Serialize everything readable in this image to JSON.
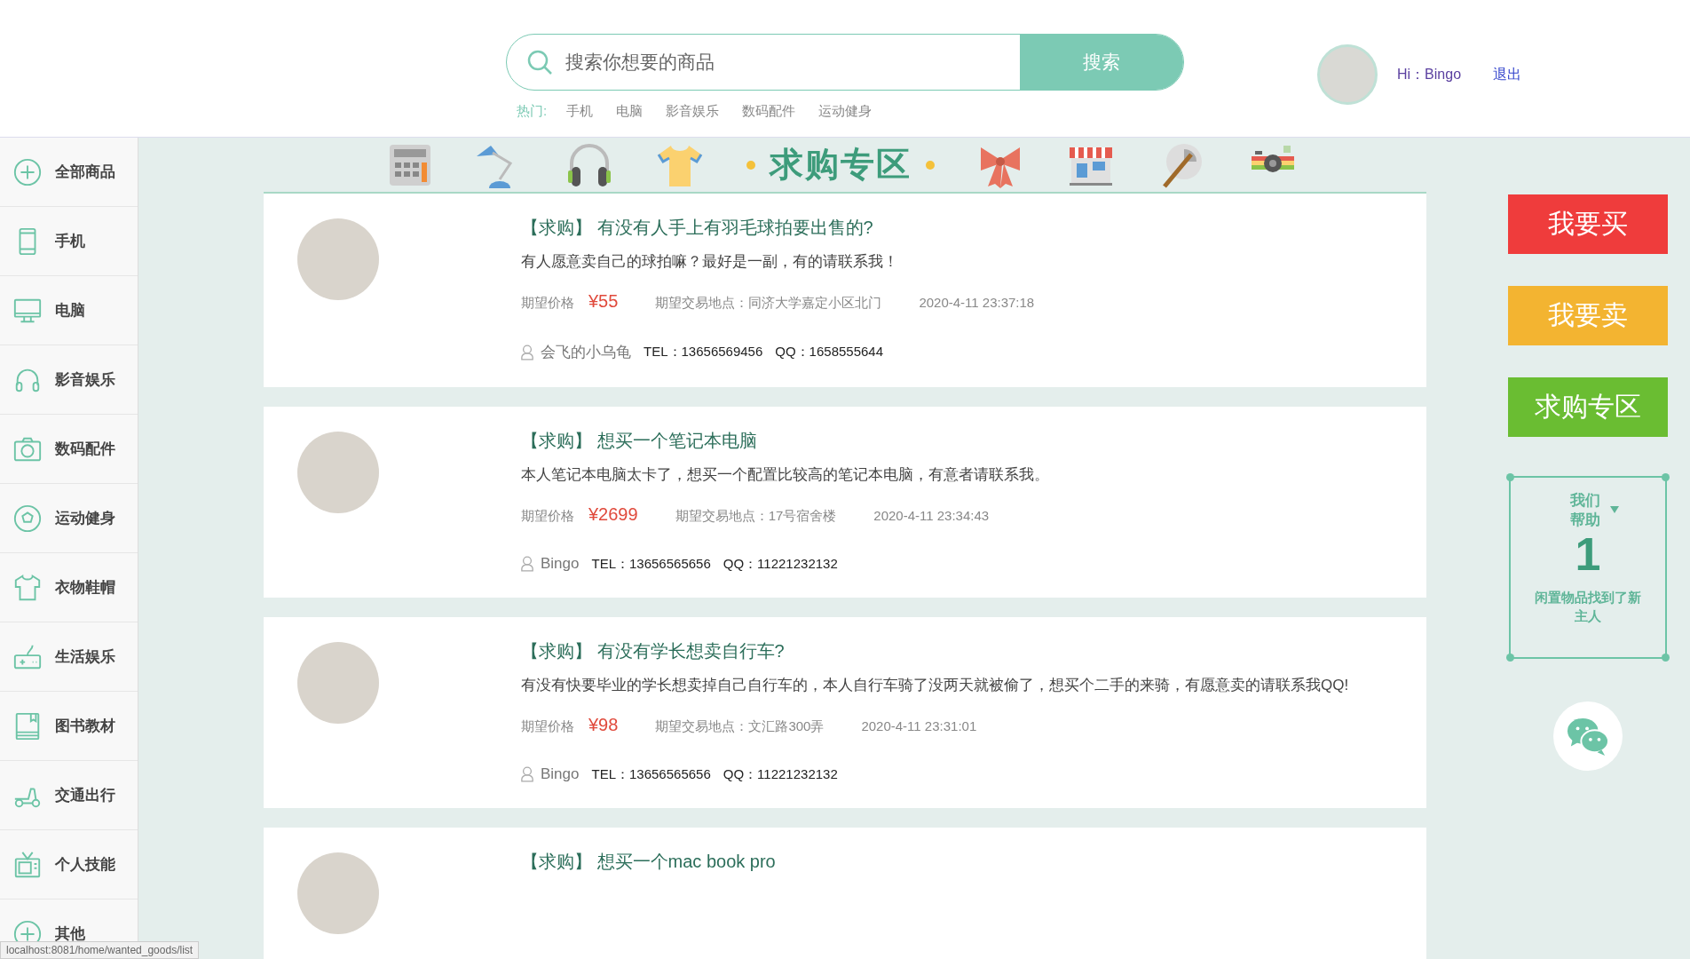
{
  "search": {
    "placeholder": "搜索你想要的商品",
    "button": "搜索"
  },
  "hot": {
    "label": "热门:",
    "items": [
      "手机",
      "电脑",
      "影音娱乐",
      "数码配件",
      "运动健身"
    ]
  },
  "user": {
    "greeting": "Hi：Bingo",
    "logout": "退出"
  },
  "sidebar": {
    "items": [
      {
        "label": "全部商品",
        "kind": "plus"
      },
      {
        "label": "手机",
        "kind": "phone"
      },
      {
        "label": "电脑",
        "kind": "monitor"
      },
      {
        "label": "影音娱乐",
        "kind": "headphones"
      },
      {
        "label": "数码配件",
        "kind": "camera"
      },
      {
        "label": "运动健身",
        "kind": "ball"
      },
      {
        "label": "衣物鞋帽",
        "kind": "shirt"
      },
      {
        "label": "生活娱乐",
        "kind": "gamepad"
      },
      {
        "label": "图书教材",
        "kind": "book"
      },
      {
        "label": "交通出行",
        "kind": "scooter"
      },
      {
        "label": "个人技能",
        "kind": "tv"
      },
      {
        "label": "其他",
        "kind": "plus"
      }
    ]
  },
  "banner": {
    "title": "求购专区"
  },
  "posts": [
    {
      "tag": "【求购】",
      "title": "有没有人手上有羽毛球拍要出售的?",
      "description": "有人愿意卖自己的球拍嘛？最好是一副，有的请联系我！",
      "price_label": "期望价格",
      "price": "¥55",
      "place_label": "期望交易地点：",
      "place": "同济大学嘉定小区北门",
      "time": "2020-4-11 23:37:18",
      "user": "会飞的小乌龟",
      "tel": "TEL：13656569456",
      "qq": "QQ：1658555644"
    },
    {
      "tag": "【求购】",
      "title": "想买一个笔记本电脑",
      "description": "本人笔记本电脑太卡了，想买一个配置比较高的笔记本电脑，有意者请联系我。",
      "price_label": "期望价格",
      "price": "¥2699",
      "place_label": "期望交易地点：",
      "place": "17号宿舍楼",
      "time": "2020-4-11 23:34:43",
      "user": "Bingo",
      "tel": "TEL：13656565656",
      "qq": "QQ：11221232132"
    },
    {
      "tag": "【求购】",
      "title": "有没有学长想卖自行车?",
      "description": "有没有快要毕业的学长想卖掉自己自行车的，本人自行车骑了没两天就被偷了，想买个二手的来骑，有愿意卖的请联系我QQ!",
      "price_label": "期望价格",
      "price": "¥98",
      "place_label": "期望交易地点：",
      "place": "文汇路300弄",
      "time": "2020-4-11 23:31:01",
      "user": "Bingo",
      "tel": "TEL：13656565656",
      "qq": "QQ：11221232132"
    },
    {
      "tag": "【求购】",
      "title": "想买一个mac book pro"
    }
  ],
  "actions": [
    {
      "label": "我要买",
      "color": "#ef3c3c"
    },
    {
      "label": "我要卖",
      "color": "#f3b431"
    },
    {
      "label": "求购专区",
      "color": "#6abd32"
    }
  ],
  "stats": {
    "heading": "我们帮助",
    "number": "1",
    "caption": "闲置物品找到了新主人"
  },
  "status_bar": "localhost:8081/home/wanted_goods/list"
}
